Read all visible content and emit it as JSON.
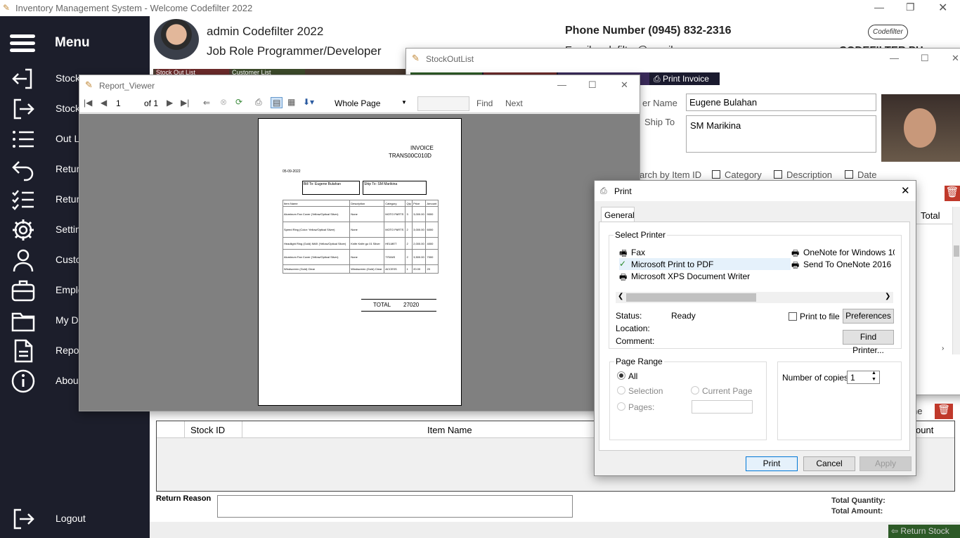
{
  "app": {
    "title": "Inventory Management System - Welcome Codefilter 2022"
  },
  "sidebar": {
    "menu_label": "Menu",
    "items": [
      {
        "label": "Stock In",
        "icon": "stock-in-icon"
      },
      {
        "label": "Stock Out",
        "icon": "stock-out-icon"
      },
      {
        "label": "Out List",
        "icon": "list-icon"
      },
      {
        "label": "Return Stock",
        "icon": "return-icon"
      },
      {
        "label": "Return List",
        "icon": "checklist-icon"
      },
      {
        "label": "Settings",
        "icon": "gear-icon"
      },
      {
        "label": "Customers",
        "icon": "user-icon"
      },
      {
        "label": "Employees",
        "icon": "briefcase-icon"
      },
      {
        "label": "My Documents",
        "icon": "folder-icon"
      },
      {
        "label": "Reports",
        "icon": "document-icon"
      },
      {
        "label": "About",
        "icon": "info-icon"
      }
    ],
    "logout": "Logout"
  },
  "header": {
    "user": "admin Codefilter 2022",
    "role": "Job Role Programmer/Developer",
    "phone": "Phone Number (0945) 832-2316",
    "email_partial": "Email codefilter@gmail",
    "brand": "CODEFILTER PH",
    "logo_text": "Codefilter"
  },
  "background_tabs": {
    "stock_out_list": "Stock Out List",
    "customer_list": "Customer List"
  },
  "stockoutlist": {
    "title": "StockOutList",
    "print_invoice": "Print Invoice",
    "customer_name_label": "er Name",
    "customer_name": "Eugene Bulahan",
    "ship_to_label": "Ship To",
    "ship_to": "SM Marikina",
    "search_label": "arch by Item ID",
    "filters": [
      "Category",
      "Description",
      "Date"
    ],
    "total_header": "Total",
    "name_label": "ne",
    "amount_header": "ount"
  },
  "return_section": {
    "columns": [
      "Stock ID",
      "Item Name"
    ],
    "reason_label": "Return Reason",
    "total_quantity": "Total Quantity:",
    "total_amount": "Total Amount:",
    "return_button": "Return Stock"
  },
  "report_viewer": {
    "title": "Report_Viewer",
    "page": "1",
    "of": "of 1",
    "zoom": "Whole Page",
    "find": "Find",
    "next": "Next",
    "invoice": {
      "heading": "INVOICE",
      "trans": "TRANS00C010D",
      "date": "05-09-2022",
      "bill_to": "Bill To: Eugene Bulahan",
      "ship_to": "Ship To: SM Marikina",
      "columns": [
        "Item Name",
        "Description",
        "Category",
        "Qty",
        "Price",
        "Amount"
      ],
      "rows": [
        [
          "Aluminum Fan Cover (Yellow/Optical Silver)",
          "None",
          "MOTO PARTS",
          "3",
          "3,000.00",
          "9000"
        ],
        [
          "Speed Ring (Color: Yellow/Optical Silver)",
          "None",
          "MOTO PARTS",
          "2",
          "3,000.00",
          "6000"
        ],
        [
          "Headlight Ring (Gold) NMX (Yellow/Optical Silver)",
          "Knife Knife go 01 Silver",
          "HELMET",
          "2",
          "2,000.00",
          "4000"
        ],
        [
          "Aluminum Fan Cover (Yellow/Optical Silver)",
          "None",
          "TITANS",
          "2",
          "3,500.00",
          "7000"
        ],
        [
          "Windscreen (Gold) Clear",
          "Windscreen (Gold) Clear",
          "ACCESS",
          "1",
          "20.00",
          "20"
        ]
      ],
      "total_label": "TOTAL",
      "total": "27020"
    }
  },
  "print_dialog": {
    "title": "Print",
    "tab": "General",
    "select_printer": "Select Printer",
    "printers": [
      "Fax",
      "OneNote for Windows 10",
      "Microsoft Print to PDF",
      "Send To OneNote 2016",
      "Microsoft XPS Document Writer"
    ],
    "selected_printer": "Microsoft Print to PDF",
    "status_label": "Status:",
    "status": "Ready",
    "location_label": "Location:",
    "comment_label": "Comment:",
    "print_to_file": "Print to file",
    "preferences": "Preferences",
    "find_printer": "Find Printer...",
    "page_range": "Page Range",
    "all": "All",
    "selection": "Selection",
    "current_page": "Current Page",
    "pages": "Pages:",
    "copies_label": "Number of copies:",
    "copies": "1",
    "print": "Print",
    "cancel": "Cancel",
    "apply": "Apply"
  },
  "colors": {
    "sidebar": "#1c1e2b",
    "accent_dark": "#1a1a2e",
    "return_button": "#2d5a27",
    "delete_red": "#c0392b"
  }
}
